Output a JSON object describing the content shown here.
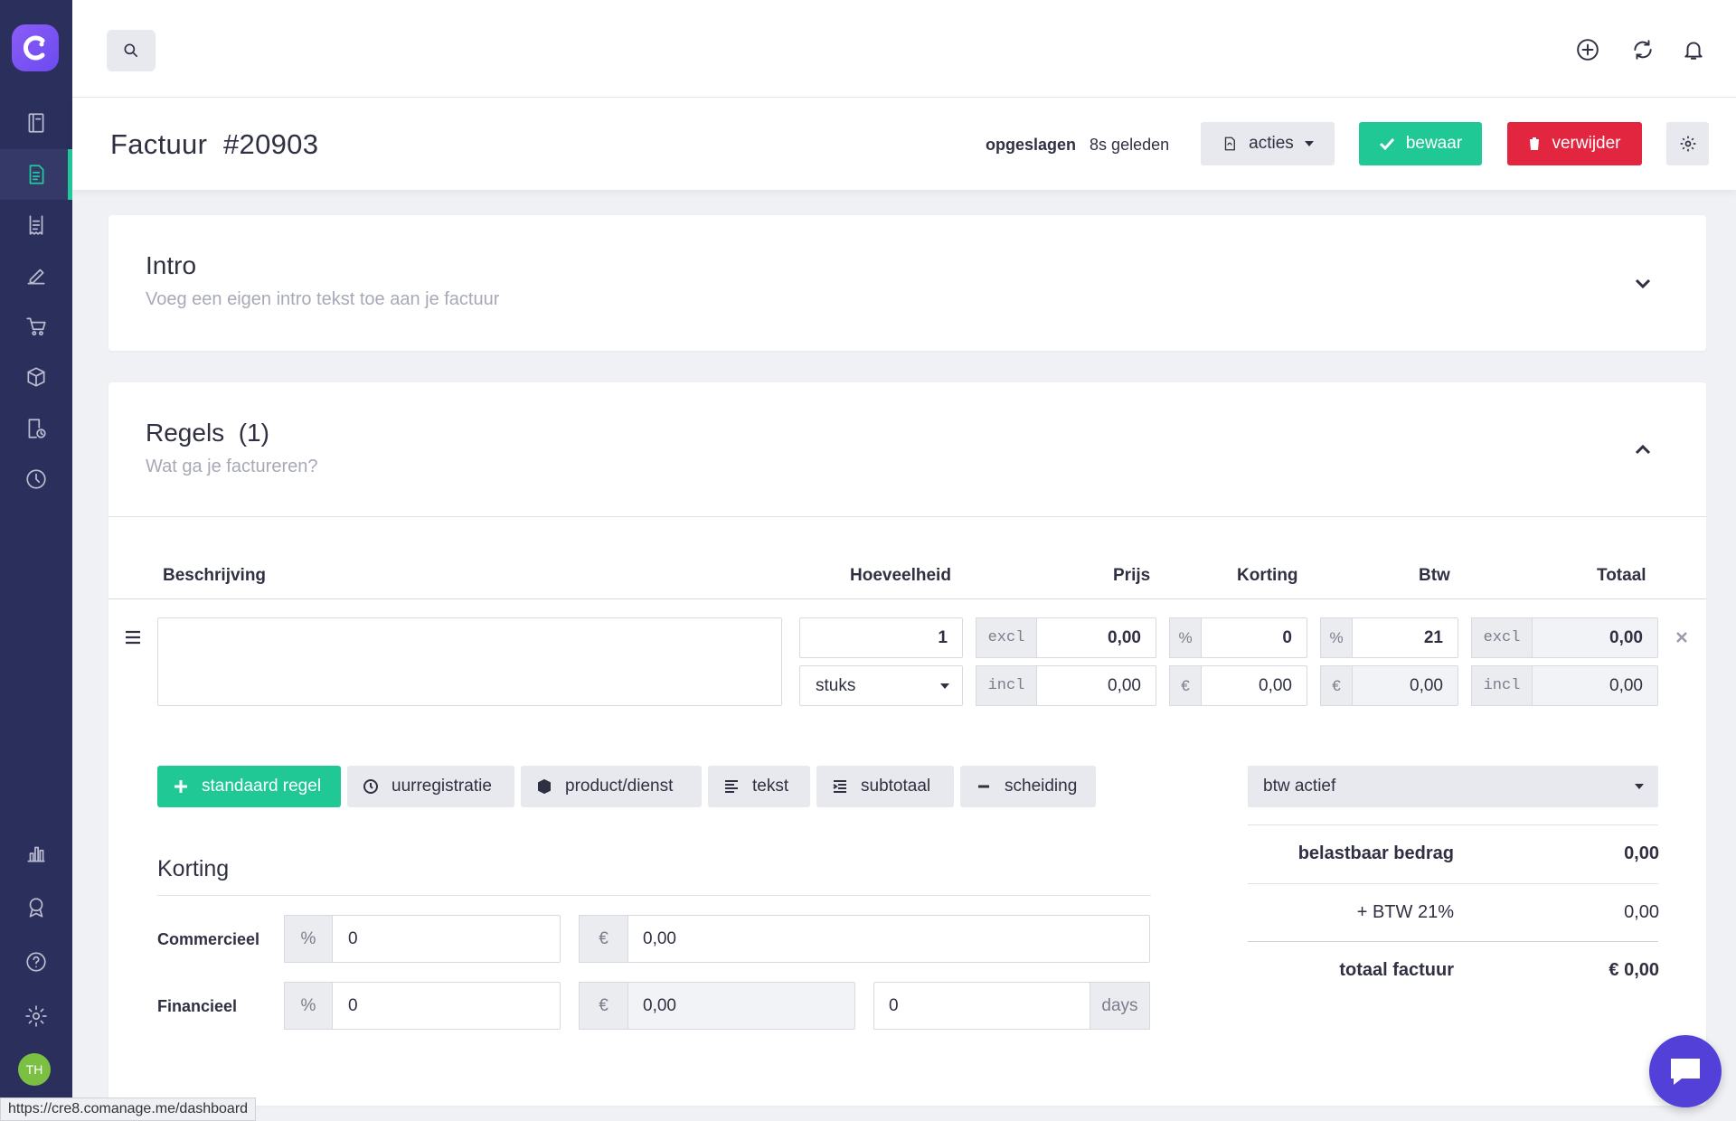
{
  "sidebar": {
    "logo": "c-logo-icon",
    "items": [
      {
        "name": "book-icon"
      },
      {
        "name": "invoice-icon",
        "active": true
      },
      {
        "name": "receipt-icon"
      },
      {
        "name": "edit-icon"
      },
      {
        "name": "cart-icon"
      },
      {
        "name": "box-icon"
      },
      {
        "name": "timesheet-icon"
      },
      {
        "name": "clock-icon"
      },
      {
        "name": "chart-icon"
      },
      {
        "name": "award-icon"
      },
      {
        "name": "help-icon"
      },
      {
        "name": "settings-icon"
      }
    ],
    "avatar": "TH"
  },
  "page": {
    "title": "Factuur  #20903",
    "saved_label": "opgeslagen",
    "saved_time": "8s geleden",
    "acties_label": "acties",
    "bewaar_label": "bewaar",
    "verwijder_label": "verwijder"
  },
  "intro": {
    "title": "Intro",
    "subtitle": "Voeg een eigen intro tekst toe aan je factuur"
  },
  "regels": {
    "title": "Regels  (1)",
    "subtitle": "Wat ga je factureren?",
    "columns": {
      "beschrijving": "Beschrijving",
      "hoeveelheid": "Hoeveelheid",
      "prijs": "Prijs",
      "korting": "Korting",
      "btw": "Btw",
      "totaal": "Totaal"
    },
    "row": {
      "description": "",
      "quantity": "1",
      "unit": "stuks",
      "excl": "excl",
      "incl": "incl",
      "price_excl": "0,00",
      "price_incl": "0,00",
      "pct": "%",
      "eur": "€",
      "discount_pct": "0",
      "discount_eur": "0,00",
      "btw_pct": "21",
      "btw_eur": "0,00",
      "total_excl": "0,00",
      "total_incl": "0,00"
    },
    "add_buttons": {
      "standaard": "standaard regel",
      "uur": "uurregistratie",
      "product": "product/dienst",
      "tekst": "tekst",
      "subtotaal": "subtotaal",
      "scheiding": "scheiding"
    },
    "btw_select": "btw actief",
    "totals": {
      "belastbaar_label": "belastbaar bedrag",
      "belastbaar_value": "0,00",
      "btw_label": "+ BTW 21%",
      "btw_value": "0,00",
      "totaal_label": "totaal factuur",
      "totaal_value": "€ 0,00"
    },
    "korting": {
      "title": "Korting",
      "commercieel": "Commercieel",
      "financieel": "Financieel",
      "pct": "%",
      "eur": "€",
      "comm_pct": "0",
      "comm_eur": "0,00",
      "fin_pct": "0",
      "fin_eur": "0,00",
      "fin_days": "0",
      "days_label": "days"
    }
  },
  "status_url": "https://cre8.comanage.me/dashboard"
}
